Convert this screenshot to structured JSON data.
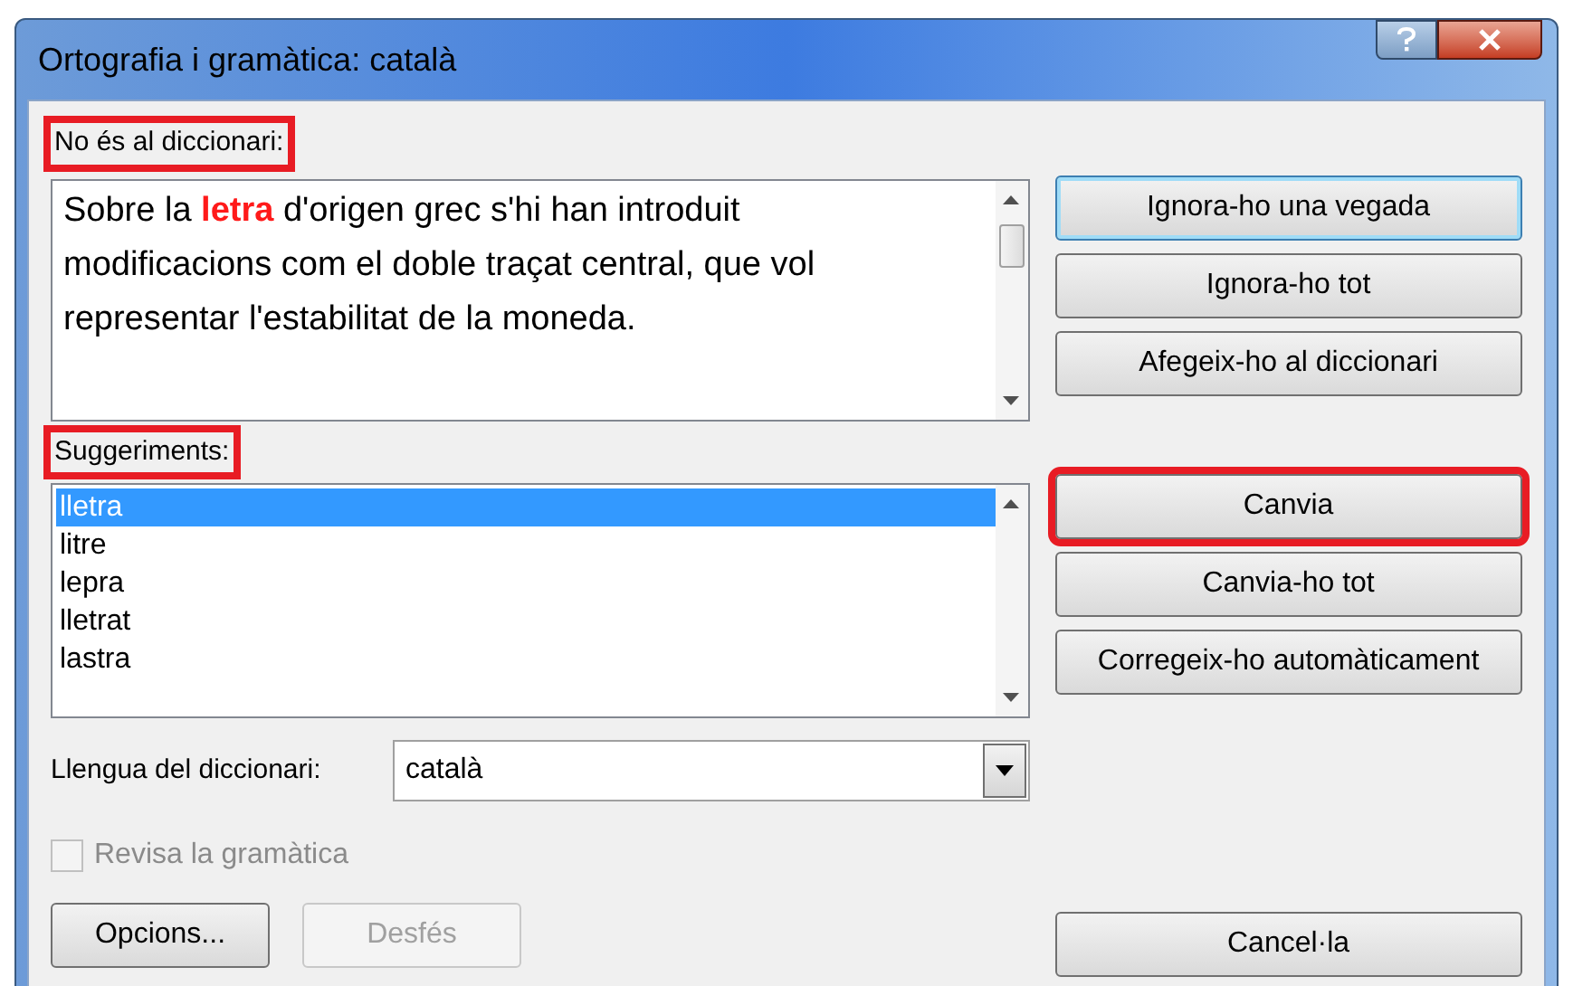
{
  "window": {
    "title": "Ortografia i gramàtica: català"
  },
  "not_in_dictionary": {
    "label": "No és al diccionari:",
    "highlighted": true,
    "text_before": "Sobre la ",
    "error_word": "letra",
    "text_after": " d'origen grec s'hi han introduit modificacions com el doble traçat central, que vol representar l'estabilitat de la moneda."
  },
  "suggestions": {
    "label": "Suggeriments:",
    "highlighted": true,
    "items": [
      {
        "text": "lletra",
        "selected": true
      },
      {
        "text": "litre",
        "selected": false
      },
      {
        "text": "lepra",
        "selected": false
      },
      {
        "text": "lletrat",
        "selected": false
      },
      {
        "text": "lastra",
        "selected": false
      }
    ]
  },
  "dictionary_language": {
    "label": "Llengua del diccionari:",
    "value": "català"
  },
  "check_grammar": {
    "label": "Revisa la gramàtica",
    "checked": false,
    "disabled": true
  },
  "bottom_buttons": [
    {
      "label": "Opcions...",
      "disabled": false
    },
    {
      "label": "Desfés",
      "disabled": true
    }
  ],
  "ignore_buttons": [
    {
      "label": "Ignora-ho una vegada",
      "focused": true,
      "highlighted": false
    },
    {
      "label": "Ignora-ho tot",
      "focused": false,
      "highlighted": false
    },
    {
      "label": "Afegeix-ho al diccionari",
      "focused": false,
      "highlighted": false
    }
  ],
  "change_buttons": [
    {
      "label": "Canvia",
      "focused": false,
      "highlighted": true
    },
    {
      "label": "Canvia-ho tot",
      "focused": false,
      "highlighted": false
    },
    {
      "label": "Corregeix-ho automàticament",
      "focused": false,
      "highlighted": false
    }
  ],
  "cancel_button": {
    "label": "Cancel·la"
  }
}
